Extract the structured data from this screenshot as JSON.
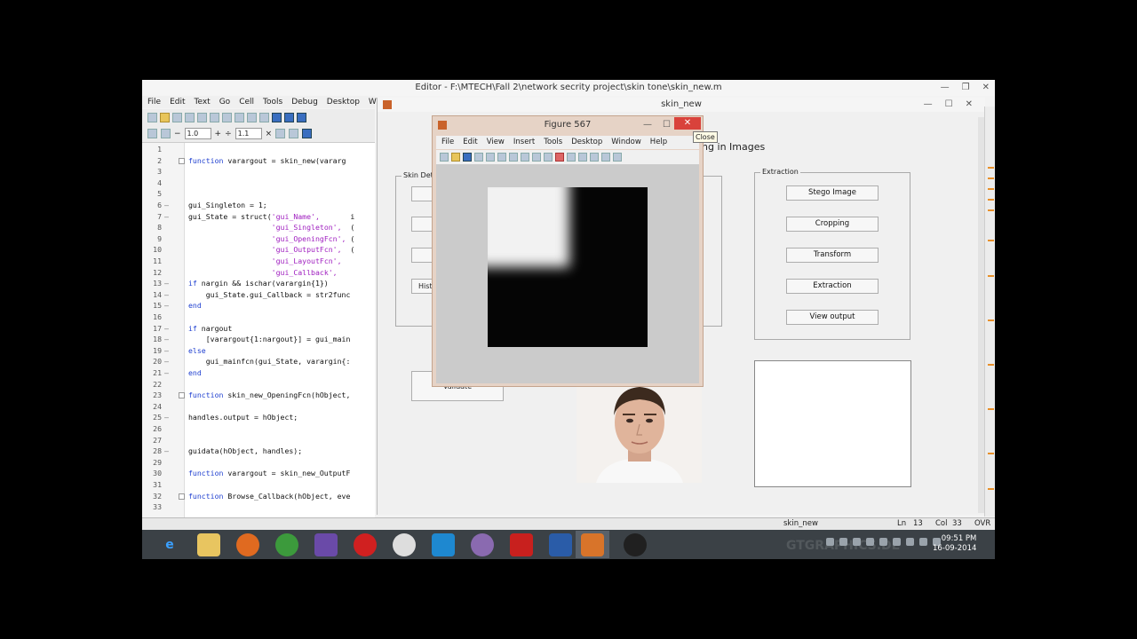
{
  "editor": {
    "title": "Editor - F:\\MTECH\\Fall 2\\network secrity project\\skin tone\\skin_new.m",
    "menu": [
      "File",
      "Edit",
      "Text",
      "Go",
      "Cell",
      "Tools",
      "Debug",
      "Desktop",
      "Windo"
    ],
    "toolbar": {
      "minus": "−",
      "indent_value": "1.0",
      "plus": "+",
      "divide": "÷",
      "spacing_value": "1.1",
      "times": "×"
    },
    "status": {
      "file": "skin_new",
      "ln": "Ln",
      "ln_value": "13",
      "col": "Col",
      "col_value": "33",
      "mode": "OVR"
    }
  },
  "code_lines": [
    {
      "n": "1",
      "dash": "",
      "fold": false,
      "text": ""
    },
    {
      "n": "2",
      "dash": "",
      "fold": true,
      "kw": "function",
      "text": " varargout = skin_new(vararg"
    },
    {
      "n": "3",
      "dash": "",
      "fold": false,
      "text": ""
    },
    {
      "n": "4",
      "dash": "",
      "fold": false,
      "text": ""
    },
    {
      "n": "5",
      "dash": "",
      "fold": false,
      "text": ""
    },
    {
      "n": "6",
      "dash": "–",
      "fold": false,
      "text": "gui_Singleton = 1;"
    },
    {
      "n": "7",
      "dash": "–",
      "fold": false,
      "text": "gui_State = struct(",
      "str": "'gui_Name',",
      "rest": "       i"
    },
    {
      "n": "8",
      "dash": "",
      "fold": false,
      "text": "                   ",
      "str": "'gui_Singleton',",
      "rest": "  ("
    },
    {
      "n": "9",
      "dash": "",
      "fold": false,
      "text": "                   ",
      "str": "'gui_OpeningFcn',",
      "rest": " ("
    },
    {
      "n": "10",
      "dash": "",
      "fold": false,
      "text": "                   ",
      "str": "'gui_OutputFcn',",
      "rest": "  ("
    },
    {
      "n": "11",
      "dash": "",
      "fold": false,
      "text": "                   ",
      "str": "'gui_LayoutFcn',",
      "rest": ""
    },
    {
      "n": "12",
      "dash": "",
      "fold": false,
      "text": "                   ",
      "str": "'gui_Callback',",
      "rest": ""
    },
    {
      "n": "13",
      "dash": "–",
      "fold": false,
      "kw": "if",
      "text": " nargin && ischar(varargin{1})"
    },
    {
      "n": "14",
      "dash": "–",
      "fold": false,
      "text": "    gui_State.gui_Callback = str2func"
    },
    {
      "n": "15",
      "dash": "–",
      "fold": false,
      "kw": "end",
      "text": ""
    },
    {
      "n": "16",
      "dash": "",
      "fold": false,
      "text": ""
    },
    {
      "n": "17",
      "dash": "–",
      "fold": false,
      "kw": "if",
      "text": " nargout"
    },
    {
      "n": "18",
      "dash": "–",
      "fold": false,
      "text": "    [varargout{1:nargout}] = gui_main"
    },
    {
      "n": "19",
      "dash": "–",
      "fold": false,
      "kw": "else",
      "text": ""
    },
    {
      "n": "20",
      "dash": "–",
      "fold": false,
      "text": "    gui_mainfcn(gui_State, varargin{:"
    },
    {
      "n": "21",
      "dash": "–",
      "fold": false,
      "kw": "end",
      "text": ""
    },
    {
      "n": "22",
      "dash": "",
      "fold": false,
      "text": ""
    },
    {
      "n": "23",
      "dash": "",
      "fold": true,
      "kw": "function",
      "text": " skin_new_OpeningFcn(hObject,"
    },
    {
      "n": "24",
      "dash": "",
      "fold": false,
      "text": ""
    },
    {
      "n": "25",
      "dash": "–",
      "fold": false,
      "text": "handles.output = hObject;"
    },
    {
      "n": "26",
      "dash": "",
      "fold": false,
      "text": ""
    },
    {
      "n": "27",
      "dash": "",
      "fold": false,
      "text": ""
    },
    {
      "n": "28",
      "dash": "–",
      "fold": false,
      "text": "guidata(hObject, handles);"
    },
    {
      "n": "29",
      "dash": "",
      "fold": false,
      "text": ""
    },
    {
      "n": "30",
      "dash": "",
      "fold": false,
      "kw": "function",
      "text": " varargout = skin_new_OutputF"
    },
    {
      "n": "31",
      "dash": "",
      "fold": false,
      "text": ""
    },
    {
      "n": "32",
      "dash": "",
      "fold": true,
      "kw": "function",
      "text": " Browse_Callback(hObject, eve"
    },
    {
      "n": "33",
      "dash": "",
      "fold": false,
      "text": ""
    }
  ],
  "gui": {
    "title": "skin_new",
    "heading_fragment": "ing in Images",
    "skin_panel_label": "Skin Dete",
    "hist_button": "Hist",
    "validate_button": "Validate",
    "extraction_panel_label": "Extraction",
    "extraction_buttons": [
      "Stego Image",
      "Cropping",
      "Transform",
      "Extraction",
      "View output"
    ]
  },
  "figure": {
    "title": "Figure 567",
    "menu": [
      "File",
      "Edit",
      "View",
      "Insert",
      "Tools",
      "Desktop",
      "Window",
      "Help"
    ],
    "close_tooltip": "Close",
    "close_glyph": "✕"
  },
  "taskbar": {
    "time": "09:51 PM",
    "date": "16-09-2014",
    "watermark": "GTGRAPHICS.DE"
  },
  "window_glyphs": {
    "minimize": "—",
    "restore": "❐",
    "close": "✕",
    "maximize": "☐"
  }
}
